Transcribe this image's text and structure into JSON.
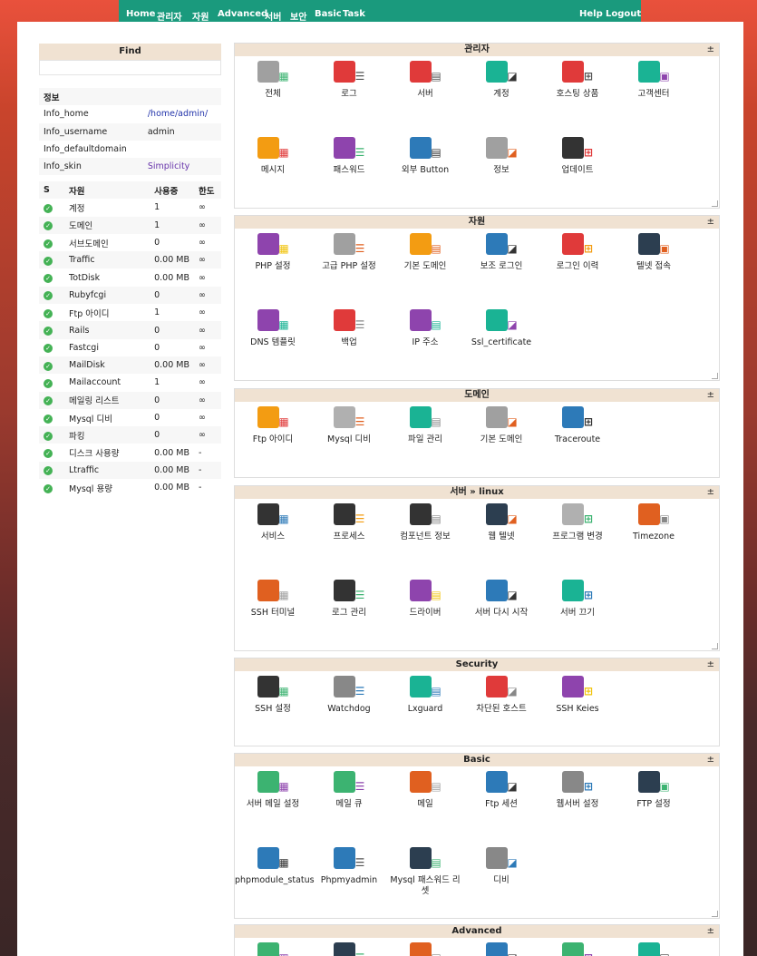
{
  "nav": {
    "left": [
      "Home",
      "관리자",
      "자원",
      "Advanced",
      "서버",
      "보안",
      "Basic",
      "Task"
    ],
    "right": [
      "Help",
      "Logout"
    ]
  },
  "find": {
    "title": "Find"
  },
  "info": {
    "header": "정보",
    "rows": [
      [
        "Info_home",
        "/home/admin/"
      ],
      [
        "Info_username",
        "admin"
      ],
      [
        "Info_defaultdomain",
        ""
      ],
      [
        "Info_skin",
        "Simplicity"
      ]
    ]
  },
  "resources": {
    "headers": [
      "S",
      "자원",
      "사용중",
      "한도"
    ],
    "rows": [
      [
        "계정",
        "1",
        "∞"
      ],
      [
        "도메인",
        "1",
        "∞"
      ],
      [
        "서브도메인",
        "0",
        "∞"
      ],
      [
        "Traffic",
        "0.00 MB",
        "∞"
      ],
      [
        "TotDisk",
        "0.00 MB",
        "∞"
      ],
      [
        "Rubyfcgi",
        "0",
        "∞"
      ],
      [
        "Ftp 아이디",
        "1",
        "∞"
      ],
      [
        "Rails",
        "0",
        "∞"
      ],
      [
        "Fastcgi",
        "0",
        "∞"
      ],
      [
        "MailDisk",
        "0.00 MB",
        "∞"
      ],
      [
        "Mailaccount",
        "1",
        "∞"
      ],
      [
        "메일링 리스트",
        "0",
        "∞"
      ],
      [
        "Mysql 디비",
        "0",
        "∞"
      ],
      [
        "파킹",
        "0",
        "∞"
      ],
      [
        "디스크 사용량",
        "0.00 MB",
        "-"
      ],
      [
        "Ltraffic",
        "0.00 MB",
        "-"
      ],
      [
        "Mysql 용량",
        "0.00 MB",
        "-"
      ]
    ]
  },
  "panels": [
    {
      "title": "관리자",
      "toggle": "±",
      "items": [
        [
          "전체",
          "#a0a0a0",
          "#3cb371"
        ],
        [
          "로그",
          "#e03a3a",
          "#555555"
        ],
        [
          "서버",
          "#e03a3a",
          "#555555"
        ],
        [
          "계정",
          "#1ab394",
          "#333333"
        ],
        [
          "호스팅 상품",
          "#e03a3a",
          "#555555"
        ],
        [
          "고객센터",
          "#1ab394",
          "#8e44ad"
        ],
        [
          "메시지",
          "#f39c12",
          "#e03a3a"
        ],
        [
          "패스워드",
          "#8e44ad",
          "#3cb371"
        ],
        [
          "외부 Button",
          "#2d7ab8",
          "#333333"
        ],
        [
          "정보",
          "#a0a0a0",
          "#e06020"
        ],
        [
          "업데이트",
          "#333333",
          "#e03a3a"
        ]
      ]
    },
    {
      "title": "자원",
      "toggle": "±",
      "items": [
        [
          "PHP 설정",
          "#8e44ad",
          "#f1c40f"
        ],
        [
          "고급 PHP 설정",
          "#a0a0a0",
          "#e06020"
        ],
        [
          "기본 도메인",
          "#f39c12",
          "#e06020"
        ],
        [
          "보조 로그인",
          "#2d7ab8",
          "#333333"
        ],
        [
          "로그인 이력",
          "#e03a3a",
          "#f39c12"
        ],
        [
          "텔넷 접속",
          "#2c3e50",
          "#e06020"
        ],
        [
          "DNS 템플릿",
          "#8e44ad",
          "#1ab394"
        ],
        [
          "백업",
          "#e03a3a",
          "#888888"
        ],
        [
          "IP 주소",
          "#8e44ad",
          "#1ab394"
        ],
        [
          "Ssl_certificate",
          "#1ab394",
          "#8e44ad"
        ]
      ]
    },
    {
      "title": "도메인",
      "toggle": "±",
      "items": [
        [
          "Ftp 아이디",
          "#f39c12",
          "#e03a3a"
        ],
        [
          "Mysql 디비",
          "#b0b0b0",
          "#e06020"
        ],
        [
          "파일 관리",
          "#1ab394",
          "#888888"
        ],
        [
          "기본 도메인",
          "#a0a0a0",
          "#e06020"
        ],
        [
          "Traceroute",
          "#2d7ab8",
          "#333333"
        ]
      ]
    },
    {
      "title": "서버 » linux",
      "toggle": "±",
      "items": [
        [
          "서비스",
          "#333333",
          "#2d7ab8"
        ],
        [
          "프로세스",
          "#333333",
          "#f39c12"
        ],
        [
          "컴포넌트 정보",
          "#333333",
          "#888888"
        ],
        [
          "웹 텔넷",
          "#2c3e50",
          "#e06020"
        ],
        [
          "프로그램 변경",
          "#b0b0b0",
          "#3cb371"
        ],
        [
          "Timezone",
          "#e06020",
          "#888888"
        ],
        [
          "SSH 터미널",
          "#e06020",
          "#a0a0a0"
        ],
        [
          "로그 관리",
          "#333333",
          "#3cb371"
        ],
        [
          "드라이버",
          "#8e44ad",
          "#f1c40f"
        ],
        [
          "서버 다시 시작",
          "#2d7ab8",
          "#333333"
        ],
        [
          "서버 끄기",
          "#1ab394",
          "#2d7ab8"
        ]
      ]
    },
    {
      "title": "Security",
      "toggle": "±",
      "items": [
        [
          "SSH 설정",
          "#333333",
          "#3cb371"
        ],
        [
          "Watchdog",
          "#888888",
          "#2d7ab8"
        ],
        [
          "Lxguard",
          "#1ab394",
          "#2d7ab8"
        ],
        [
          "차단된 호스트",
          "#e03a3a",
          "#888888"
        ],
        [
          "SSH Keies",
          "#8e44ad",
          "#f1c40f"
        ]
      ]
    },
    {
      "title": "Basic",
      "toggle": "±",
      "items": [
        [
          "서버 메일 설정",
          "#3cb371",
          "#8e44ad"
        ],
        [
          "메일 큐",
          "#3cb371",
          "#8e44ad"
        ],
        [
          "메일",
          "#e06020",
          "#a0a0a0"
        ],
        [
          "Ftp 세션",
          "#2d7ab8",
          "#333333"
        ],
        [
          "웹서버 설정",
          "#888888",
          "#2d7ab8"
        ],
        [
          "FTP 설정",
          "#2c3e50",
          "#3cb371"
        ],
        [
          "phpmodule_status",
          "#2d7ab8",
          "#333333"
        ],
        [
          "Phpmyadmin",
          "#2d7ab8",
          "#555555"
        ],
        [
          "Mysql 패스워드 리셋",
          "#2c3e50",
          "#3cb371"
        ],
        [
          "디비",
          "#888888",
          "#2d7ab8"
        ]
      ]
    },
    {
      "title": "Advanced",
      "toggle": "±",
      "items": [
        [
          "",
          "#3cb371",
          "#8e44ad"
        ],
        [
          "",
          "#2c3e50",
          "#3cb371"
        ],
        [
          "",
          "#e06020",
          "#888888"
        ],
        [
          "",
          "#2d7ab8",
          "#333333"
        ],
        [
          "",
          "#3cb371",
          "#8e44ad"
        ],
        [
          "",
          "#1ab394",
          "#333333"
        ]
      ]
    }
  ]
}
